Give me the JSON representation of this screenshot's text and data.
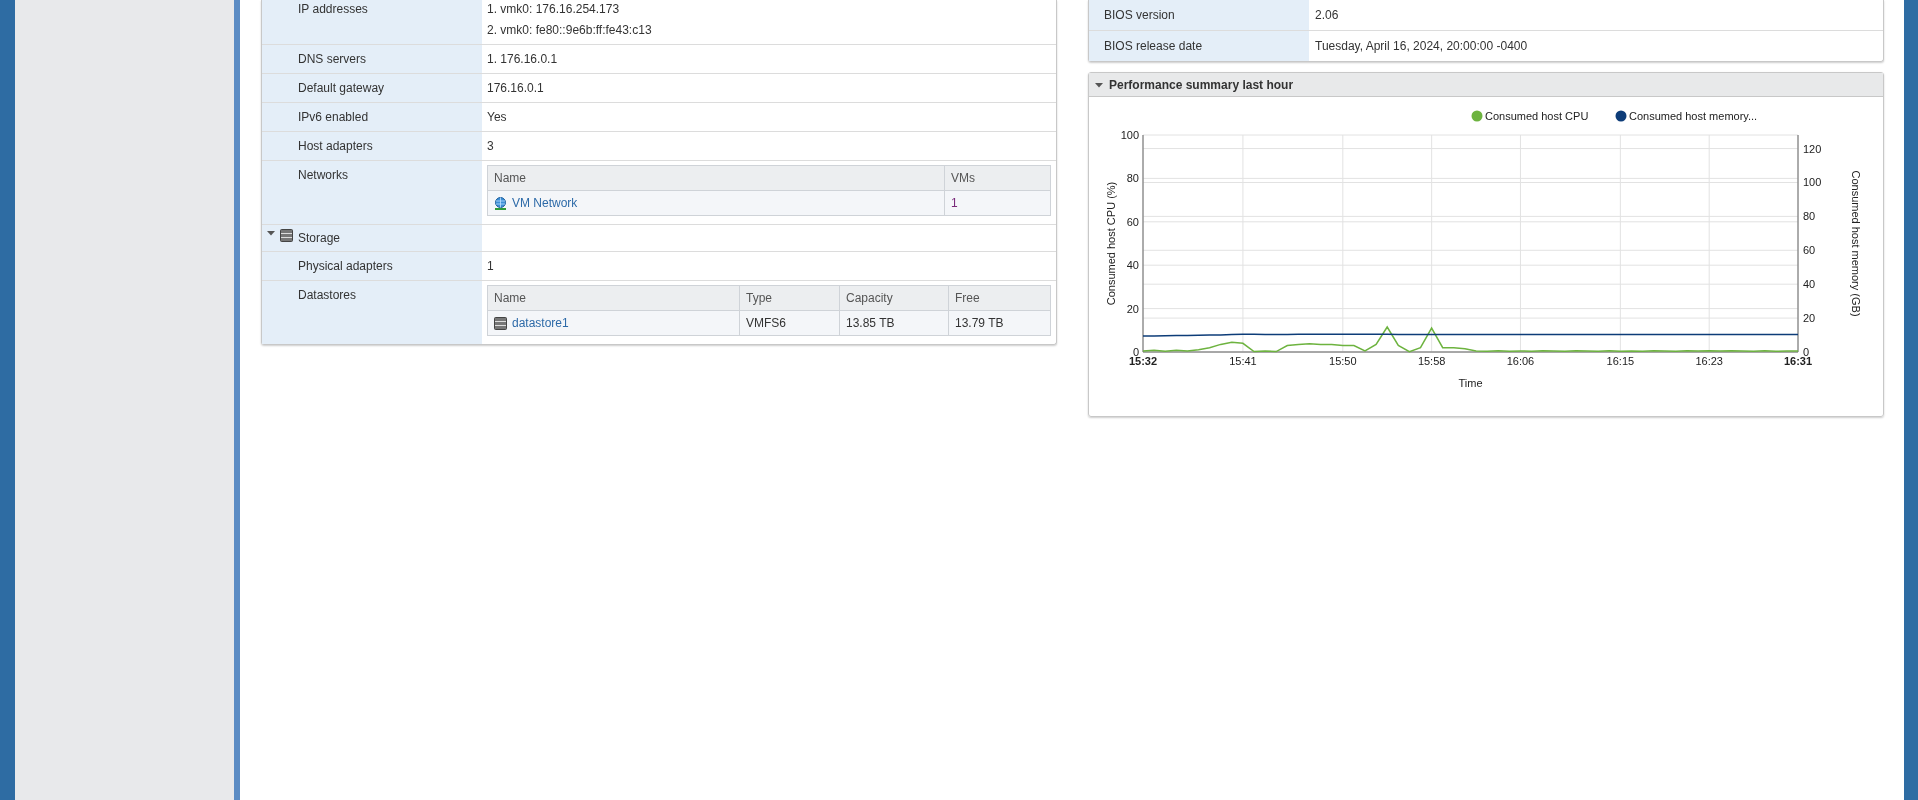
{
  "network": {
    "rows": [
      {
        "kind": "text",
        "label": "IP addresses",
        "values": [
          "1. vmk0: 176.16.254.173",
          "2. vmk0: fe80::9e6b:ff:fe43:c13"
        ]
      },
      {
        "kind": "text",
        "label": "DNS servers",
        "values": [
          "1. 176.16.0.1"
        ]
      },
      {
        "kind": "text",
        "label": "Default gateway",
        "values": [
          "176.16.0.1"
        ]
      },
      {
        "kind": "text",
        "label": "IPv6 enabled",
        "values": [
          "Yes"
        ]
      },
      {
        "kind": "text",
        "label": "Host adapters",
        "values": [
          "3"
        ]
      },
      {
        "kind": "table",
        "label": "Networks",
        "table": {
          "kind": "network",
          "columns": [
            "Name",
            "VMs"
          ],
          "rows": [
            [
              "VM Network",
              "1"
            ]
          ]
        }
      },
      {
        "kind": "section",
        "label": "Storage",
        "expanded": true
      },
      {
        "kind": "text",
        "label": "Physical adapters",
        "values": [
          "1"
        ]
      },
      {
        "kind": "table",
        "label": "Datastores",
        "table": {
          "kind": "datastore",
          "columns": [
            "Name",
            "Type",
            "Capacity",
            "Free"
          ],
          "rows": [
            [
              "datastore1",
              "VMFS6",
              "13.85 TB",
              "13.79 TB"
            ]
          ]
        }
      }
    ]
  },
  "hardware": {
    "rows": [
      {
        "label": "BIOS version",
        "value": "2.06"
      },
      {
        "label": "BIOS release date",
        "value": "Tuesday, April 16, 2024, 20:00:00 -0400"
      }
    ]
  },
  "performance": {
    "title": "Performance summary last hour",
    "expanded": true,
    "chart_data": {
      "type": "line",
      "xlabel": "Time",
      "ylabel": "Consumed host CPU (%)",
      "y2label": "Consumed host memory (GB)",
      "categories": [
        "15:32",
        null,
        null,
        null,
        null,
        null,
        null,
        null,
        null,
        "15:41",
        null,
        null,
        null,
        null,
        null,
        null,
        null,
        null,
        "15:50",
        null,
        null,
        null,
        null,
        null,
        null,
        null,
        "15:58",
        null,
        null,
        null,
        null,
        null,
        null,
        null,
        "16:06",
        null,
        null,
        null,
        null,
        null,
        null,
        null,
        null,
        "16:15",
        null,
        null,
        null,
        null,
        null,
        null,
        null,
        "16:23",
        null,
        null,
        null,
        null,
        null,
        null,
        null,
        "16:31"
      ],
      "ylim": [
        0,
        100
      ],
      "y2lim": [
        0,
        128
      ],
      "grid": true,
      "legend": "top",
      "yticks": [
        0,
        20,
        40,
        60,
        80,
        100
      ],
      "y2ticks": [
        0,
        20,
        40,
        60,
        80,
        100,
        120
      ],
      "series": [
        {
          "name": "Consumed host CPU",
          "color": "#6db33f",
          "axis": "y",
          "values": [
            0.5,
            0.8,
            0.3,
            0.8,
            0.4,
            1,
            2,
            3.5,
            4.5,
            4,
            0.2,
            0.5,
            0.2,
            3,
            3.5,
            3.8,
            3.5,
            3.5,
            3,
            3,
            0.5,
            3.5,
            11.5,
            3,
            0.2,
            2,
            11,
            2,
            2,
            1.5,
            0.5,
            0.3,
            0.6,
            0.3,
            0.5,
            0.3,
            0.6,
            0.5,
            0.3,
            0.6,
            0.5,
            0.3,
            0.6,
            0.3,
            0.5,
            0.3,
            0.6,
            0.5,
            0.3,
            0.6,
            0.5,
            0.6,
            0.5,
            0.6,
            0.5,
            0.3,
            0.6,
            0.3,
            0.5,
            0.5
          ]
        },
        {
          "name": "Consumed host memory...",
          "color": "#0d3c78",
          "axis": "y2",
          "values": [
            9.5,
            9.5,
            9.6,
            9.7,
            9.8,
            9.9,
            10,
            10.1,
            10.3,
            10.5,
            10.5,
            10.4,
            10.4,
            10.4,
            10.5,
            10.5,
            10.5,
            10.5,
            10.5,
            10.5,
            10.5,
            10.5,
            10.5,
            10.4,
            10.4,
            10.4,
            10.4,
            10.4,
            10.4,
            10.4,
            10.4,
            10.4,
            10.4,
            10.4,
            10.4,
            10.4,
            10.4,
            10.4,
            10.4,
            10.4,
            10.4,
            10.4,
            10.4,
            10.4,
            10.4,
            10.4,
            10.4,
            10.4,
            10.4,
            10.4,
            10.4,
            10.4,
            10.4,
            10.4,
            10.4,
            10.4,
            10.4,
            10.4,
            10.4,
            10.4
          ]
        }
      ]
    }
  }
}
